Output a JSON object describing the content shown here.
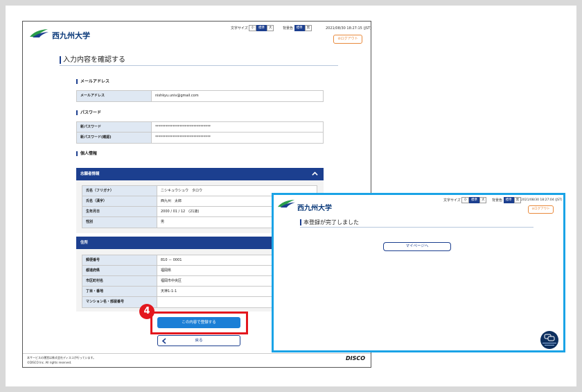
{
  "main": {
    "logo_text": "西九州大学",
    "font_size_label": "文字サイズ",
    "font_size_options": [
      "小",
      "標準",
      "大"
    ],
    "bg_color_label": "背景色",
    "bg_color_options": [
      "標準",
      "黒"
    ],
    "timestamp": "2021/08/30 18:27:15 (JST)",
    "logout_label": "ログアウト",
    "page_title": "入力内容を確認する",
    "section_email": "メールアドレス",
    "email_label": "メールアドレス",
    "email_value": "nishkyu.univ@gmail.com",
    "section_password": "パスワード",
    "password_rows": [
      {
        "label": "新パスワード",
        "value": "********************************"
      },
      {
        "label": "新パスワード(確認)",
        "value": "********************************"
      }
    ],
    "section_personal": "個人情報",
    "applicant_panel_title": "志願者情報",
    "applicant_rows": [
      {
        "label": "氏名（フリガナ）",
        "value": "ニシキュウシュウ　タロウ"
      },
      {
        "label": "氏名（漢字）",
        "value": "西九州　太郎"
      },
      {
        "label": "生年月日",
        "value": "2000 / 01 / 12　(21歳)"
      },
      {
        "label": "性別",
        "value": "男"
      }
    ],
    "address_panel_title": "住所",
    "address_rows": [
      {
        "label": "郵便番号",
        "value": "810 － 0001"
      },
      {
        "label": "都道府県",
        "value": "福岡県"
      },
      {
        "label": "市区町村名",
        "value": "福岡市中央区"
      },
      {
        "label": "丁目・番地",
        "value": "天神1-1-1"
      },
      {
        "label": "マンション名・部屋番号",
        "value": ""
      }
    ],
    "submit_label": "この内容で登録する",
    "back_label": "戻る",
    "footer_note": "本サービスの運営は株式会社ディスコが行っています。",
    "footer_copyright": "©DISCO Inc. All rights reserved.",
    "footer_brand": "DISCO"
  },
  "step_badge": "4",
  "popup": {
    "logo_text": "西九州大学",
    "font_size_label": "文字サイズ",
    "font_size_options": [
      "小",
      "標準",
      "大"
    ],
    "bg_color_label": "背景色",
    "bg_color_options": [
      "標準",
      "黒"
    ],
    "timestamp": "2021/08/30 18:27:04 (JST)",
    "logout_label": "ログアウト",
    "page_title": "本登録が完了しました",
    "mypage_label": "マイページへ"
  },
  "colors": {
    "brand_navy": "#1c3f8f",
    "primary_blue": "#1b7fd6",
    "callout_red": "#e3171e",
    "popup_border": "#1aa3e6",
    "logout_orange": "#e98a3c"
  }
}
